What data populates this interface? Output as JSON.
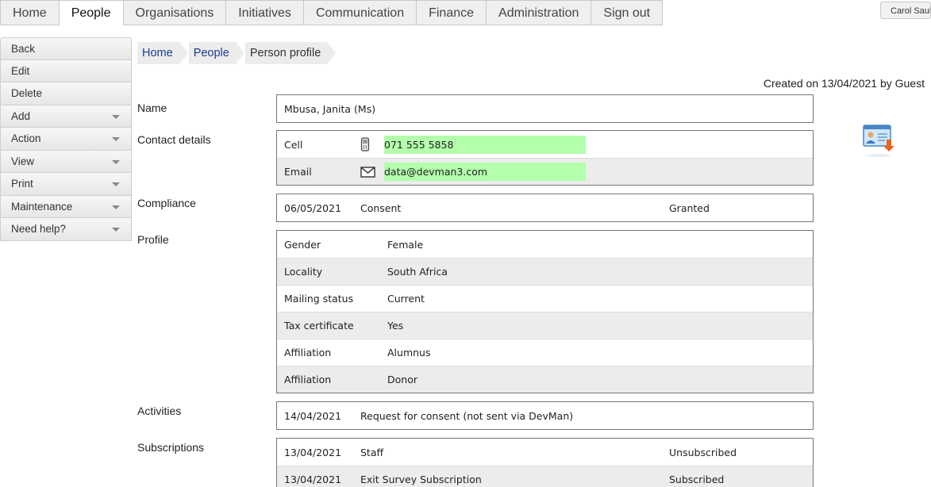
{
  "topnav": {
    "tabs": [
      {
        "label": "Home"
      },
      {
        "label": "People"
      },
      {
        "label": "Organisations"
      },
      {
        "label": "Initiatives"
      },
      {
        "label": "Communication"
      },
      {
        "label": "Finance"
      },
      {
        "label": "Administration"
      },
      {
        "label": "Sign out"
      }
    ],
    "active": "People"
  },
  "user": {
    "name": "Carol Saul"
  },
  "sidemenu": {
    "items": [
      {
        "label": "Back"
      },
      {
        "label": "Edit"
      },
      {
        "label": "Delete"
      },
      {
        "label": "Add"
      },
      {
        "label": "Action"
      },
      {
        "label": "View"
      },
      {
        "label": "Print"
      },
      {
        "label": "Maintenance"
      },
      {
        "label": "Need help?"
      }
    ]
  },
  "breadcrumb": [
    {
      "label": "Home"
    },
    {
      "label": "People"
    },
    {
      "label": "Person profile"
    }
  ],
  "created_text": "Created on 13/04/2021 by Guest",
  "sections": {
    "name": {
      "label": "Name",
      "value": "Mbusa, Janita (Ms)"
    },
    "contact": {
      "label": "Contact details",
      "rows": [
        {
          "type": "Cell",
          "icon": "mobile-phone-icon",
          "value": "071 555 5858"
        },
        {
          "type": "Email",
          "icon": "envelope-icon",
          "value": "data@devman3.com"
        }
      ]
    },
    "compliance": {
      "label": "Compliance",
      "rows": [
        {
          "date": "06/05/2021",
          "item": "Consent",
          "status": "Granted"
        }
      ]
    },
    "profile": {
      "label": "Profile",
      "rows": [
        {
          "key": "Gender",
          "value": "Female"
        },
        {
          "key": "Locality",
          "value": "South Africa"
        },
        {
          "key": "Mailing status",
          "value": "Current"
        },
        {
          "key": "Tax certificate",
          "value": "Yes"
        },
        {
          "key": "Affiliation",
          "value": "Alumnus"
        },
        {
          "key": "Affiliation",
          "value": "Donor"
        }
      ]
    },
    "activities": {
      "label": "Activities",
      "rows": [
        {
          "date": "14/04/2021",
          "item": "Request for consent (not sent via DevMan)"
        }
      ]
    },
    "subscriptions": {
      "label": "Subscriptions",
      "rows": [
        {
          "date": "13/04/2021",
          "item": "Staff",
          "status": "Unsubscribed"
        },
        {
          "date": "13/04/2021",
          "item": "Exit Survey Subscription",
          "status": "Subscribed"
        }
      ]
    }
  },
  "colors": {
    "highlight": "#b3ffab",
    "link": "#1a3c8c",
    "alt_row": "#ececec"
  }
}
